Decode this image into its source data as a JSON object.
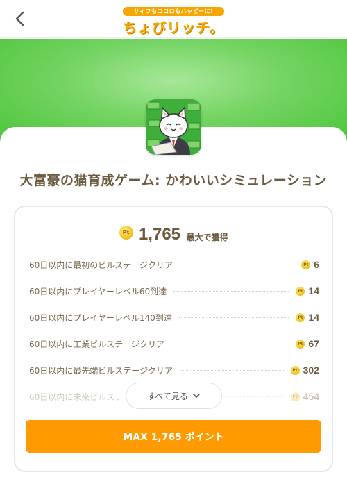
{
  "header": {
    "back_icon": "chevron-left-icon",
    "logo_tagline": "サイフもココロもハッピーに!",
    "logo_text": "ちょびリッチ。"
  },
  "app": {
    "icon": "cat-businessman-app-icon",
    "title": "大富豪の猫育成ゲーム: かわいいシミュレーション"
  },
  "points": {
    "coin_glyph": "Pt",
    "total": "1,765",
    "total_suffix": "最大で獲得",
    "rows": [
      {
        "label": "60日以内に最初のビルステージクリア",
        "points": "6"
      },
      {
        "label": "60日以内にプレイヤーレベル60到達",
        "points": "14"
      },
      {
        "label": "60日以内にプレイヤーレベル140到達",
        "points": "14"
      },
      {
        "label": "60日以内に工業ビルステージクリア",
        "points": "67"
      },
      {
        "label": "60日以内に最先端ビルステージクリア",
        "points": "302"
      },
      {
        "label": "60日以内に未来ビルステージクリア",
        "points": "454"
      }
    ],
    "see_all_label": "すべて見る",
    "max_button_label": "MAX 1,765 ポイント"
  },
  "colors": {
    "accent": "#ff9a00",
    "hero_green": "#5ccb4a",
    "text_brown": "#6b5a3e",
    "coin_gold": "#f3c623"
  }
}
